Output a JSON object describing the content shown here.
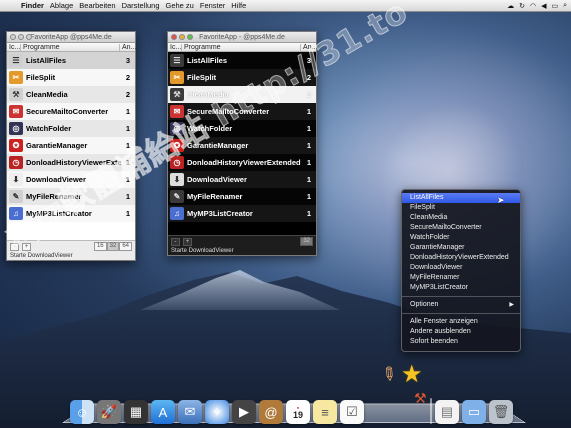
{
  "menubar": {
    "app": "Finder",
    "items": [
      "Ablage",
      "Bearbeiten",
      "Darstellung",
      "Gehe zu",
      "Fenster",
      "Hilfe"
    ],
    "status_icons": [
      "cloud-icon",
      "sync-icon",
      "wifi-icon",
      "volume-icon",
      "battery-icon",
      "search-icon"
    ]
  },
  "window_light": {
    "title": "FavoriteApp @pps4Me.de",
    "header": {
      "icon": "Ic...",
      "name": "Programme",
      "count": "An..."
    },
    "rows": [
      {
        "name": "ListAllFiles",
        "count": "3",
        "icon": "list-icon"
      },
      {
        "name": "FileSplit",
        "count": "2",
        "icon": "split-icon"
      },
      {
        "name": "CleanMedia",
        "count": "2",
        "icon": "broom-icon"
      },
      {
        "name": "SecureMailtoConverter",
        "count": "1",
        "icon": "envelope-icon"
      },
      {
        "name": "WatchFolder",
        "count": "1",
        "icon": "binoculars-icon"
      },
      {
        "name": "GarantieManager",
        "count": "1",
        "icon": "badge-icon"
      },
      {
        "name": "DonloadHistoryViewerExtended",
        "count": "1",
        "icon": "history-icon"
      },
      {
        "name": "DownloadViewer",
        "count": "1",
        "icon": "download-icon"
      },
      {
        "name": "MyFileRenamer",
        "count": "1",
        "icon": "pen-icon"
      },
      {
        "name": "MyMP3ListCreator",
        "count": "1",
        "icon": "music-icon"
      }
    ],
    "footer": {
      "minus": "-",
      "plus": "+",
      "sizes": [
        "16",
        "32",
        "64"
      ],
      "status": "Starte DownloadViewer"
    }
  },
  "window_dark": {
    "title": "FavoriteApp - @pps4Me.de",
    "header": {
      "icon": "Ic...",
      "name": "Programme",
      "count": "An..."
    },
    "rows": [
      {
        "name": "ListAllFiles",
        "count": "3",
        "icon": "list-icon"
      },
      {
        "name": "FileSplit",
        "count": "2",
        "icon": "split-icon"
      },
      {
        "name": "CleanMedia",
        "count": "2",
        "icon": "broom-icon"
      },
      {
        "name": "SecureMailtoConverter",
        "count": "1",
        "icon": "envelope-icon"
      },
      {
        "name": "WatchFolder",
        "count": "1",
        "icon": "binoculars-icon"
      },
      {
        "name": "GarantieManager",
        "count": "1",
        "icon": "badge-icon"
      },
      {
        "name": "DonloadHistoryViewerExtended",
        "count": "1",
        "icon": "history-icon"
      },
      {
        "name": "DownloadViewer",
        "count": "1",
        "icon": "download-icon"
      },
      {
        "name": "MyFileRenamer",
        "count": "1",
        "icon": "pen-icon"
      },
      {
        "name": "MyMP3ListCreator",
        "count": "1",
        "icon": "music-icon"
      }
    ],
    "footer": {
      "minus": "-",
      "plus": "+",
      "sizes": [
        "32"
      ],
      "status": "Starte DownloadViewer"
    }
  },
  "dock_menu": {
    "apps": [
      "ListAllFiles",
      "FileSplit",
      "CleanMedia",
      "SecureMailtoConverter",
      "WatchFolder",
      "GarantieManager",
      "DonloadHistoryViewerExtended",
      "DownloadViewer",
      "MyFileRenamer",
      "MyMP3ListCreator"
    ],
    "options": "Optionen",
    "show_all": "Alle Fenster anzeigen",
    "hide_others": "Andere ausblenden",
    "quit": "Sofort beenden"
  },
  "dock": {
    "items": [
      "finder-icon",
      "launchpad-icon",
      "mission-control-icon",
      "app-store-icon",
      "mail-icon",
      "safari-icon",
      "facetime-icon",
      "contacts-icon",
      "calendar-icon",
      "notes-icon",
      "reminders-icon",
      "pencil-app-icon",
      "favoriteapp-star-icon",
      "document-icon",
      "folder-icon",
      "trash-icon"
    ],
    "calendar_day": "19"
  },
  "watermark": "xyz軟體補給站 http://31.to"
}
